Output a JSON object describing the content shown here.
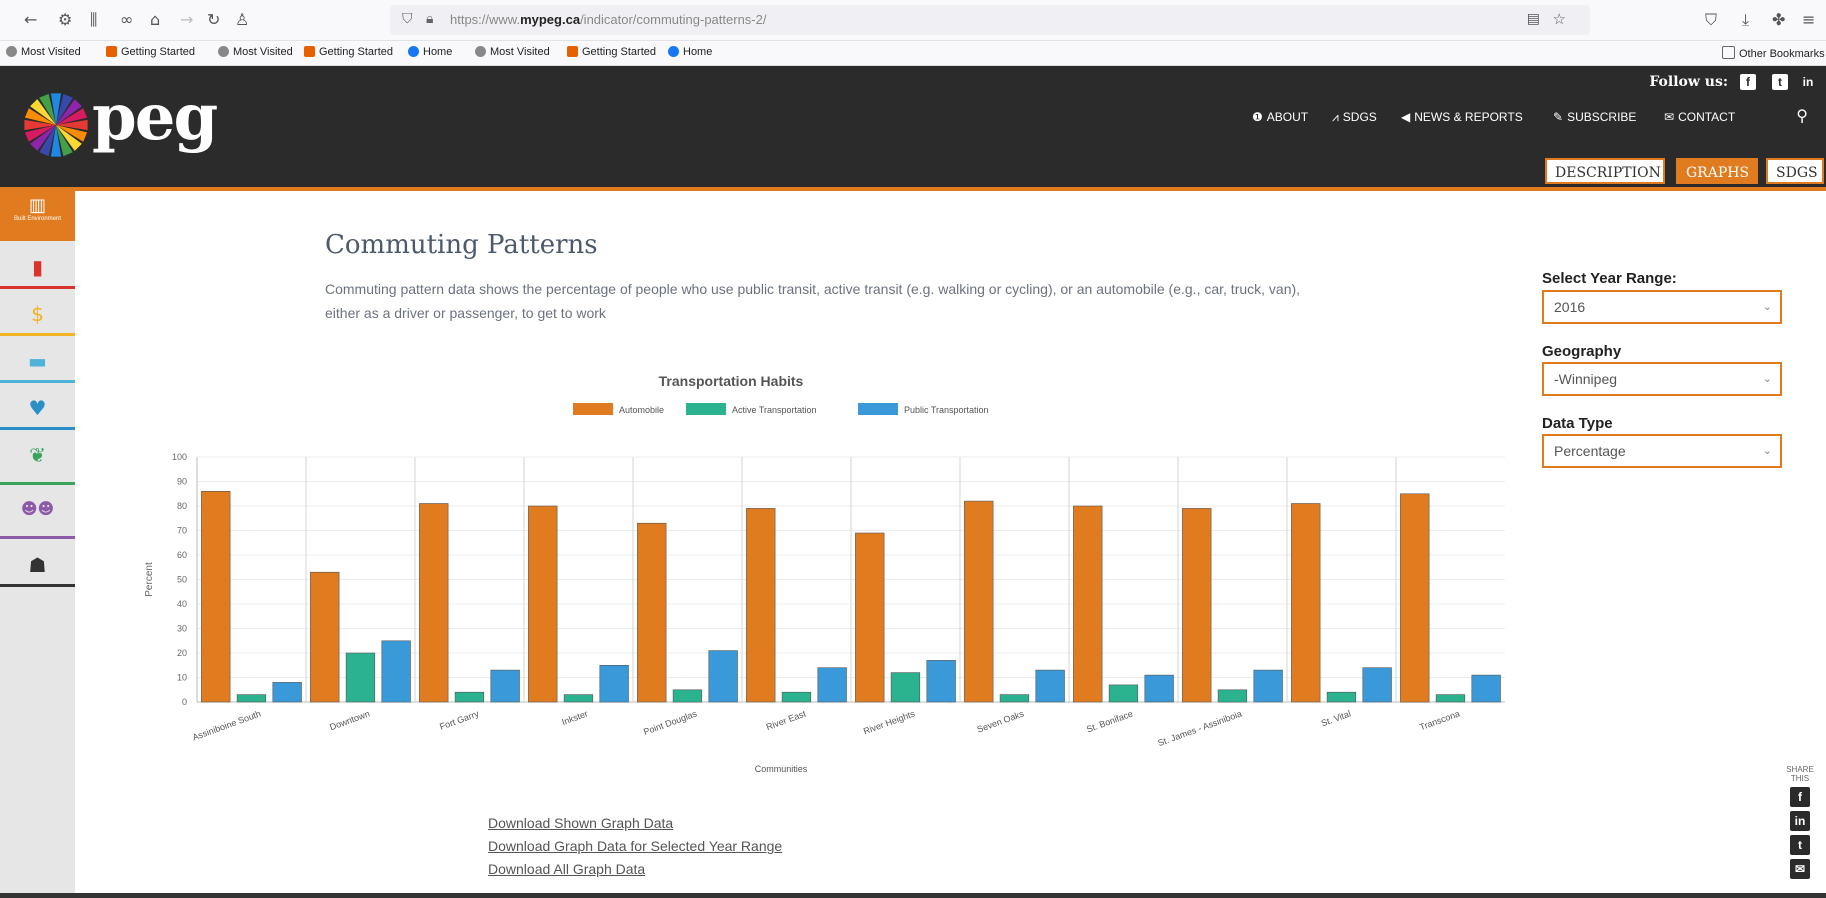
{
  "browser": {
    "url_domain": "mypeg.ca",
    "url_rest": "/indicator/commuting-patterns-2/",
    "url_prefix": "https://www.",
    "bookmarks": [
      "Most Visited",
      "Getting Started",
      "Most Visited",
      "Getting Started",
      "Home",
      "Most Visited",
      "Getting Started",
      "Home"
    ],
    "other_bookmarks": "Other Bookmarks"
  },
  "header": {
    "logo": "peg",
    "follow_label": "Follow us:",
    "social": [
      "f",
      "t",
      "in"
    ],
    "nav": [
      {
        "label": "ABOUT",
        "icon": "info-icon"
      },
      {
        "label": "SDGS",
        "icon": "chart-icon"
      },
      {
        "label": "NEWS & REPORTS",
        "icon": "megaphone-icon"
      },
      {
        "label": "SUBSCRIBE",
        "icon": "pencil-icon"
      },
      {
        "label": "CONTACT",
        "icon": "envelope-icon"
      }
    ],
    "tabs": [
      "DESCRIPTION",
      "GRAPHS",
      "SDGS"
    ],
    "active_tab": "GRAPHS"
  },
  "sidebar": {
    "items": [
      {
        "name": "built-environment",
        "label": "Built Environment",
        "color": "#e07b1f"
      },
      {
        "name": "lungs",
        "color": "#d9342b"
      },
      {
        "name": "dollar",
        "color": "#f0b323"
      },
      {
        "name": "book",
        "color": "#4fb2d9"
      },
      {
        "name": "heart",
        "color": "#2a8fc9"
      },
      {
        "name": "leaf",
        "color": "#3aa35c"
      },
      {
        "name": "people",
        "color": "#8d5aa8"
      },
      {
        "name": "head",
        "color": "#333333"
      }
    ]
  },
  "main": {
    "title": "Commuting Patterns",
    "description": "Commuting pattern data shows the percentage of people who use public transit, active transit (e.g. walking or cycling), or an automobile (e.g., car, truck, van), either as a driver or passenger, to get to work",
    "downloads": [
      "Download Shown Graph Data",
      "Download Graph Data for Selected Year Range",
      "Download All Graph Data"
    ]
  },
  "filters": {
    "year_label": "Select Year Range:",
    "year_value": "2016",
    "geo_label": "Geography",
    "geo_value": "-Winnipeg",
    "type_label": "Data Type",
    "type_value": "Percentage"
  },
  "share": {
    "label": "SHARE THIS"
  },
  "chart_data": {
    "type": "bar",
    "title": "Transportation Habits",
    "xlabel": "Communities",
    "ylabel": "Percent",
    "ylim": [
      0,
      100
    ],
    "yticks": [
      0,
      10,
      20,
      30,
      40,
      50,
      60,
      70,
      80,
      90,
      100
    ],
    "categories": [
      "Assiniboine South",
      "Downtown",
      "Fort Garry",
      "Inkster",
      "Point Douglas",
      "River East",
      "River Heights",
      "Seven Oaks",
      "St. Boniface",
      "St. James - Assiniboia",
      "St. Vital",
      "Transcona"
    ],
    "series": [
      {
        "name": "Automobile",
        "color": "#e07b1f",
        "values": [
          86,
          53,
          81,
          80,
          73,
          79,
          69,
          82,
          80,
          79,
          81,
          85
        ]
      },
      {
        "name": "Active Transportation",
        "color": "#2bb38f",
        "values": [
          3,
          20,
          4,
          3,
          5,
          4,
          12,
          3,
          7,
          5,
          4,
          3
        ]
      },
      {
        "name": "Public Transportation",
        "color": "#3a99d8",
        "values": [
          8,
          25,
          13,
          15,
          21,
          14,
          17,
          13,
          11,
          13,
          14,
          11
        ]
      }
    ],
    "legend_position": "top",
    "grid": true
  }
}
